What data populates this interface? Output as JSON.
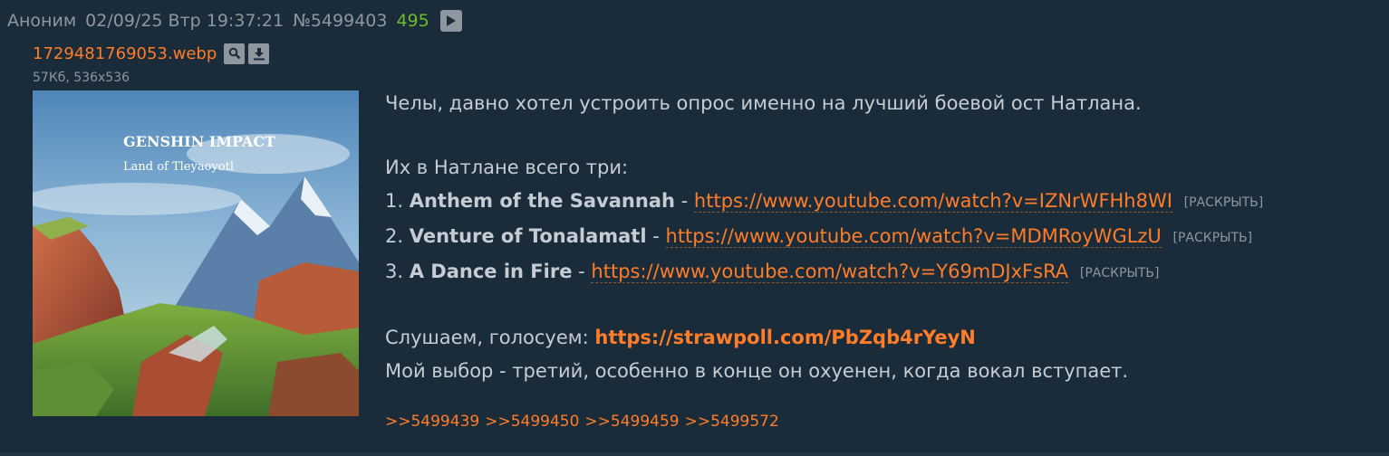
{
  "header": {
    "name": "Аноним",
    "date": "02/09/25 Втр 19:37:21",
    "post_number": "№5499403",
    "replies_count": "495"
  },
  "file": {
    "name": "1729481769053.webp",
    "meta": "57Кб, 536x536",
    "image_title_logo": "GENSHIN IMPACT",
    "image_subtitle": "Land of Tleyaoyotl"
  },
  "message": {
    "line1": "Челы, давно хотел устроить опрос именно на лучший боевой ост Натлана.",
    "line2": "Их в Натлане всего три:",
    "tracks": [
      {
        "num": "1.",
        "title": "Anthem of the Savannah",
        "sep": "-",
        "url": "https://www.youtube.com/watch?v=IZNrWFHh8WI",
        "expand": "[РАСКРЫТЬ]"
      },
      {
        "num": "2.",
        "title": "Venture of Tonalamatl",
        "sep": "-",
        "url": "https://www.youtube.com/watch?v=MDMRoyWGLzU",
        "expand": "[РАСКРЫТЬ]"
      },
      {
        "num": "3.",
        "title": "A Dance in Fire",
        "sep": "-",
        "url": "https://www.youtube.com/watch?v=Y69mDJxFsRA",
        "expand": "[РАСКРЫТЬ]"
      }
    ],
    "vote_prefix": "Слушаем, голосуем:",
    "poll_url": "https://strawpoll.com/PbZqb4rYeyN",
    "line_last": "Мой выбор - третий, особенно в конце он охуенен, когда вокал вступает."
  },
  "replies": [
    ">>5499439",
    ">>5499450",
    ">>5499459",
    ">>5499572"
  ],
  "colors": {
    "background": "#1a2b3a",
    "text": "#c6ccd3",
    "muted": "#8e979f",
    "link": "#ff7d28",
    "count": "#6cbd2c"
  }
}
